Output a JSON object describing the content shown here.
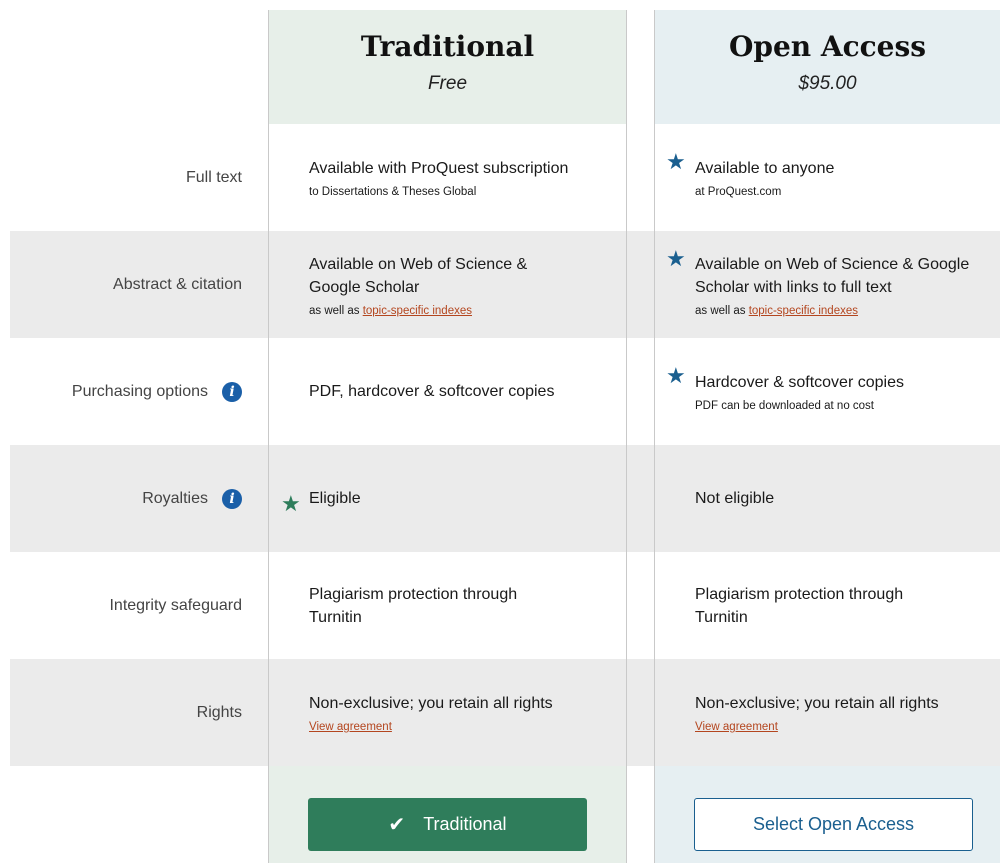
{
  "columns": {
    "traditional": {
      "title": "Traditional",
      "price": "Free"
    },
    "open_access": {
      "title": "Open Access",
      "price": "$95.00"
    }
  },
  "rows": [
    {
      "label": "Full text",
      "traditional": {
        "main": "Available with ProQuest subscription",
        "sub": "to Dissertations & Theses Global"
      },
      "open_access": {
        "main": "Available to anyone",
        "sub": "at ProQuest.com"
      }
    },
    {
      "label": "Abstract & citation",
      "traditional": {
        "main": "Available on Web of Science & Google Scholar",
        "sub_prefix": "as well as ",
        "sub_link": "topic-specific indexes"
      },
      "open_access": {
        "main": "Available on Web of Science & Google Scholar with links to full text",
        "sub_prefix": "as well as ",
        "sub_link": "topic-specific indexes"
      }
    },
    {
      "label": "Purchasing options",
      "traditional": {
        "main": "PDF, hardcover & softcover copies"
      },
      "open_access": {
        "main": "Hardcover & softcover copies",
        "sub": "PDF can be downloaded at no cost"
      }
    },
    {
      "label": "Royalties",
      "traditional": {
        "main": "Eligible"
      },
      "open_access": {
        "main": "Not eligible"
      }
    },
    {
      "label": "Integrity safeguard",
      "traditional": {
        "main": "Plagiarism protection through Turnitin"
      },
      "open_access": {
        "main": "Plagiarism protection through Turnitin"
      }
    },
    {
      "label": "Rights",
      "traditional": {
        "main": "Non-exclusive; you retain all rights",
        "link": "View agreement"
      },
      "open_access": {
        "main": "Non-exclusive; you retain all rights",
        "link": "View agreement"
      }
    }
  ],
  "buttons": {
    "traditional": "Traditional",
    "open_access": "Select Open Access"
  },
  "icons": {
    "star": "star-icon",
    "info": "info-icon",
    "check": "check-icon"
  },
  "colors": {
    "brand_green": "#2f7d5b",
    "brand_blue": "#1a5f8f",
    "link": "#b4461f",
    "info": "#1a5fa8"
  }
}
